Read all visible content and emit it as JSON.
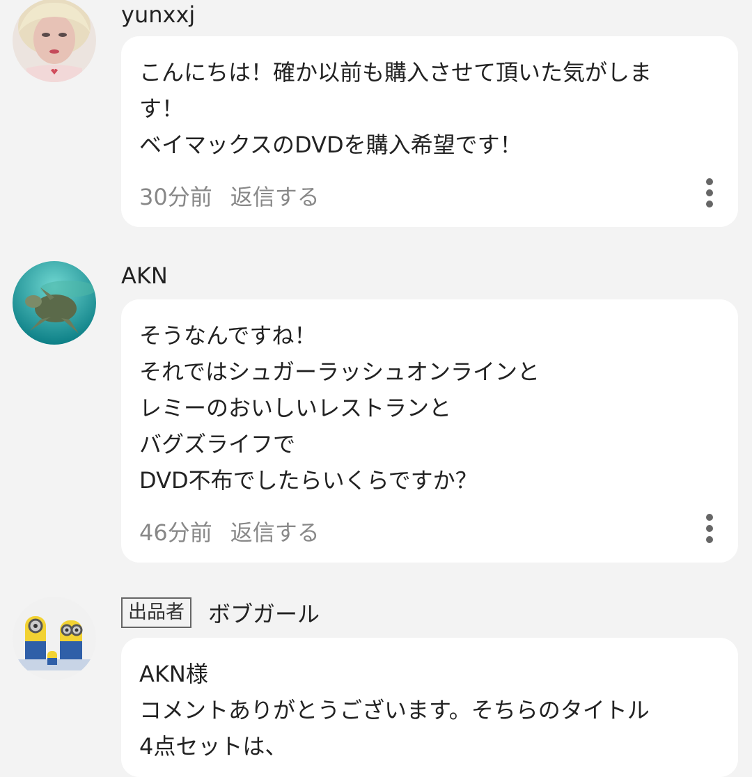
{
  "comments": [
    {
      "username": "yunxxj",
      "badge": "",
      "lines": [
        "こんにちは！確か以前も購入させて頂いた気がしま",
        "す！",
        "ベイマックスのDVDを購入希望です！"
      ],
      "time": "30分前",
      "reply": "返信する",
      "avatar_icon": "woman-portrait-avatar"
    },
    {
      "username": "AKN",
      "badge": "",
      "lines": [
        "そうなんですね！",
        "それではシュガーラッシュオンラインと",
        "レミーのおいしいレストランと",
        "バグズライフで",
        "DVD不布でしたらいくらですか？"
      ],
      "time": "46分前",
      "reply": "返信する",
      "avatar_icon": "sea-turtle-avatar"
    },
    {
      "username": "ボブガール",
      "badge": "出品者",
      "lines": [
        "AKN様",
        "コメントありがとうございます。そちらのタイトル",
        "4点セットは、"
      ],
      "time": "",
      "reply": "",
      "avatar_icon": "minions-avatar"
    }
  ],
  "colors": {
    "background": "#f3f3f3",
    "bubble": "#ffffff",
    "text": "#222222",
    "muted": "#888888"
  }
}
